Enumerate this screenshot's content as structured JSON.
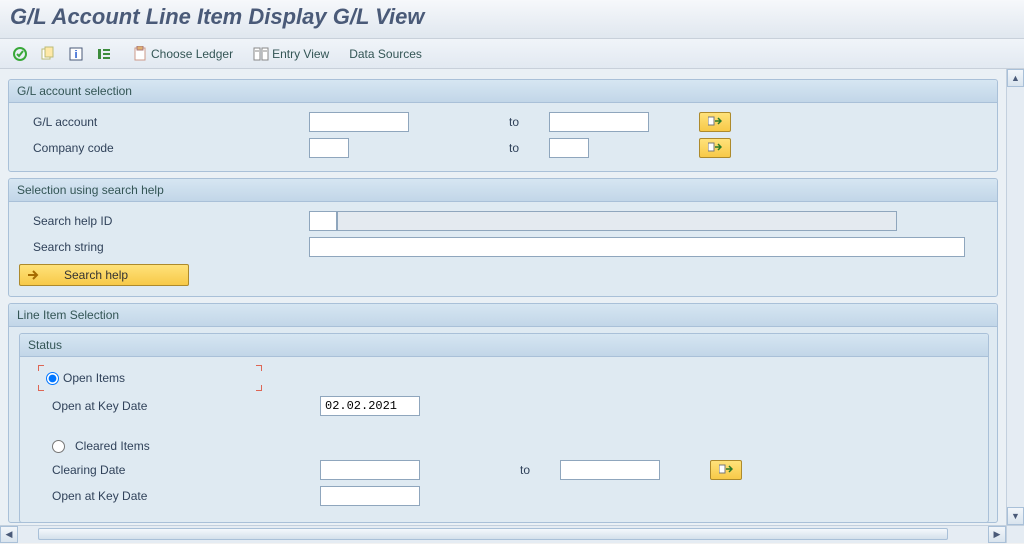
{
  "title": "G/L Account Line Item Display G/L View",
  "toolbar": {
    "choose_ledger": "Choose Ledger",
    "entry_view": "Entry View",
    "data_sources": "Data Sources"
  },
  "gl_selection": {
    "header": "G/L account selection",
    "account_label": "G/L account",
    "company_label": "Company code",
    "to_label": "to",
    "account_from": "",
    "account_to": "",
    "company_from": "",
    "company_to": ""
  },
  "search_help": {
    "header": "Selection using search help",
    "id_label": "Search help ID",
    "id_value": "",
    "id_desc": "",
    "string_label": "Search string",
    "string_value": "",
    "button_label": "Search help"
  },
  "line_item": {
    "header": "Line Item Selection",
    "status_header": "Status",
    "open_items_label": "Open Items",
    "open_key_date_label": "Open at Key Date",
    "open_key_date_value": "02.02.2021",
    "cleared_items_label": "Cleared Items",
    "clearing_date_label": "Clearing Date",
    "clearing_date_from": "",
    "clearing_date_to": "",
    "to_label": "to",
    "cleared_key_date_label": "Open at Key Date",
    "cleared_key_date_value": ""
  }
}
